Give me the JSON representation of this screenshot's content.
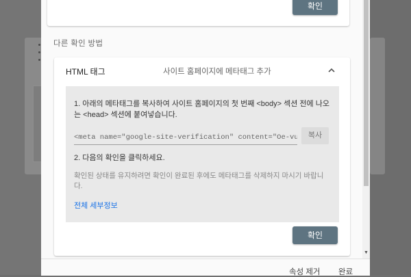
{
  "top_card": {
    "confirm_label": "확인"
  },
  "other_methods": {
    "label": "다른 확인 방법",
    "html_tag": {
      "title": "HTML 태그",
      "subtitle": "사이트 홈페이지에 메타태그 추가",
      "step1": "1. 아래의 메타태그를 복사하여 사이트 홈페이지의 첫 번째 <body> 섹션 전에 나오는 <head> 섹션에 붙여넣습니다.",
      "meta_value": "<meta name=\"google-site-verification\" content=\"Oe-vuCREtUJD",
      "copy_label": "복사",
      "step2": "2. 다음의 확인을 클릭하세요.",
      "note": "확인된 상태를 유지하려면 확인이 완료된 후에도 메타태그를 삭제하지 마시기 바랍니다.",
      "details_link": "전체 세부정보",
      "confirm_label": "확인"
    }
  },
  "footer": {
    "remove_property": "속성 제거",
    "done": "완료"
  },
  "colors": {
    "button": "#5e7481",
    "link": "#1a73e8",
    "overlay": "#757575"
  }
}
